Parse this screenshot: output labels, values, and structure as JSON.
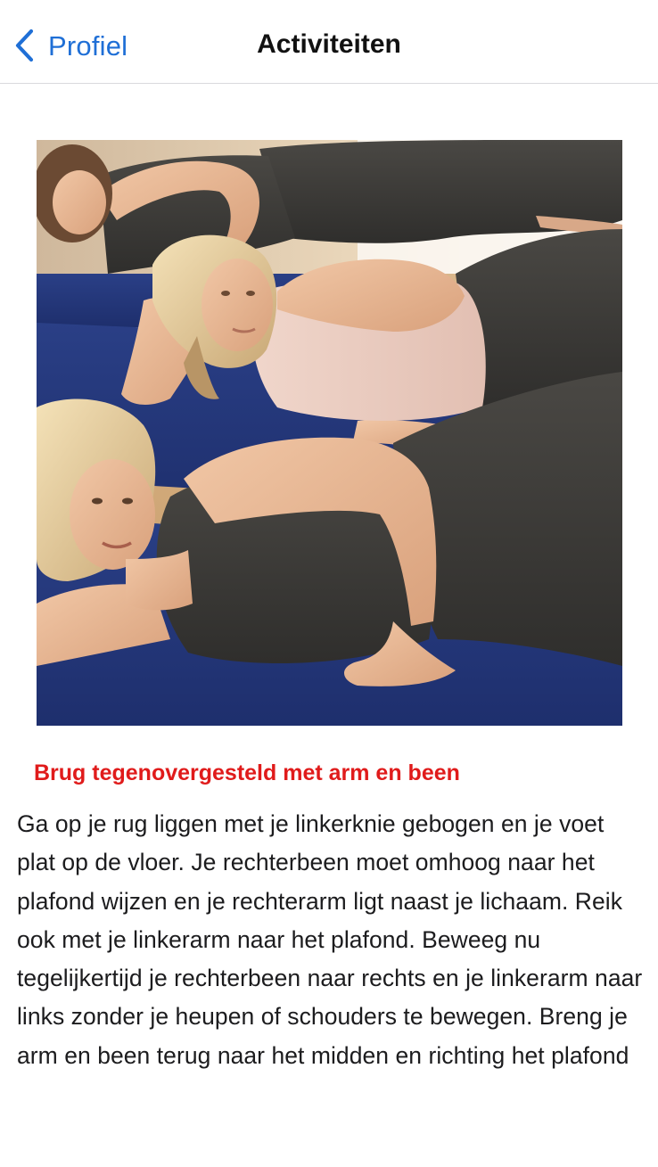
{
  "nav": {
    "back_label": "Profiel",
    "title": "Activiteiten"
  },
  "icons": {
    "back": "chevron-left-icon"
  },
  "colors": {
    "accent": "#1f6fd6",
    "title_red": "#e01b1b",
    "text": "#1c1c1e"
  },
  "exercise": {
    "title": "Brug tegenovergesteld met arm en been",
    "description": "Ga op je rug liggen met je linkerknie gebogen en je voet plat op de vloer. Je rechterbeen moet omhoog naar het plafond wijzen en je rechterarm ligt naast je lichaam. Reik ook met je linkerarm naar het plafond. Beweeg nu tegelijkertijd je rechterbeen naar rechts en je linkerarm naar links zonder je heupen of schouders te bewegen. Breng je arm en been terug naar het midden en richting het plafond"
  }
}
